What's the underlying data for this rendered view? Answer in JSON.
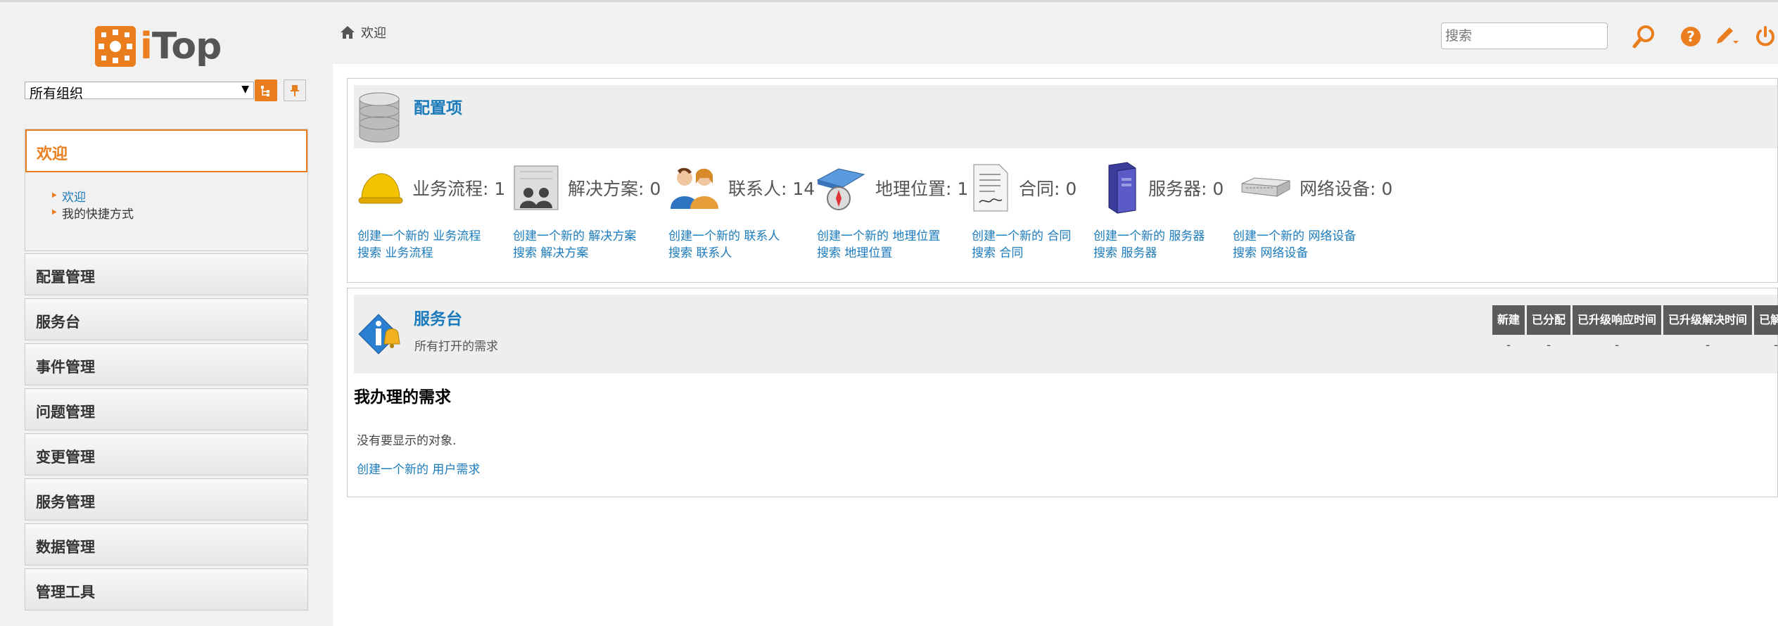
{
  "brand": {
    "name": "iTop"
  },
  "sidebar": {
    "org_select_value": "所有组织",
    "welcome_menu": {
      "title": "欢迎",
      "items": [
        {
          "label": "欢迎",
          "active": true
        },
        {
          "label": "我的快捷方式",
          "active": false
        }
      ]
    },
    "menu_items": [
      {
        "label": "配置管理"
      },
      {
        "label": "服务台"
      },
      {
        "label": "事件管理"
      },
      {
        "label": "问题管理"
      },
      {
        "label": "变更管理"
      },
      {
        "label": "服务管理"
      },
      {
        "label": "数据管理"
      },
      {
        "label": "管理工具"
      }
    ]
  },
  "header": {
    "breadcrumb": "欢迎",
    "search_placeholder": "搜索"
  },
  "config_panel": {
    "title": "配置项",
    "summary": [
      {
        "label": "业务流程: 1",
        "create": "创建一个新的 业务流程",
        "search": "搜索 业务流程",
        "icon": "hardhat-icon"
      },
      {
        "label": "解决方案: 0",
        "create": "创建一个新的 解决方案",
        "search": "搜索 解决方案",
        "icon": "solution-icon"
      },
      {
        "label": "联系人: 14",
        "create": "创建一个新的 联系人",
        "search": "搜索 联系人",
        "icon": "contacts-icon"
      },
      {
        "label": "地理位置: 1",
        "create": "创建一个新的 地理位置",
        "search": "搜索 地理位置",
        "icon": "location-icon"
      },
      {
        "label": "合同: 0",
        "create": "创建一个新的 合同",
        "search": "搜索 合同",
        "icon": "contract-icon"
      },
      {
        "label": "服务器: 0",
        "create": "创建一个新的 服务器",
        "search": "搜索 服务器",
        "icon": "server-icon"
      },
      {
        "label": "网络设备: 0",
        "create": "创建一个新的 网络设备",
        "search": "搜索 网络设备",
        "icon": "network-device-icon"
      }
    ]
  },
  "service_desk_panel": {
    "title": "服务台",
    "subtitle": "所有打开的需求",
    "columns": [
      {
        "header": "新建",
        "value": "-"
      },
      {
        "header": "已分配",
        "value": "-"
      },
      {
        "header": "已升级响应时间",
        "value": "-"
      },
      {
        "header": "已升级解决时间",
        "value": "-"
      },
      {
        "header": "已解决",
        "value": "-"
      }
    ],
    "my_requests_title": "我办理的需求",
    "no_objects": "没有要显示的对象.",
    "create_request": "创建一个新的 用户需求"
  },
  "colors": {
    "accent": "#ea7d1e",
    "link": "#1a7abb",
    "table_header": "#5b5b5b"
  }
}
